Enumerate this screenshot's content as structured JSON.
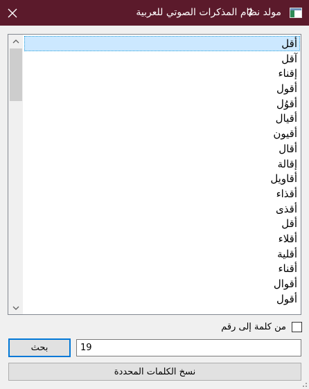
{
  "window": {
    "title": "مولد نظام المذكرات الصوتي للعربية",
    "help_label": "?"
  },
  "word_list": {
    "items": [
      "أقل",
      "آقل",
      "إقناء",
      "أقول",
      "أقوُل",
      "أقيال",
      "أقيون",
      "أقال",
      "إقالة",
      "أقاويل",
      "أقذاء",
      "أقذى",
      "أقل",
      "أقلاء",
      "أقلية",
      "أقناء",
      "أقوال",
      "أقول"
    ],
    "selected_index": 0
  },
  "options": {
    "word_to_number_label": "من كلمة إلى رقم",
    "word_to_number_checked": false
  },
  "search": {
    "button_label": "بحث",
    "number_value": "19"
  },
  "copy": {
    "button_label": "نسخ الكلمات المحددة"
  },
  "colors": {
    "titlebar": "#5b1a2b",
    "selection": "#cce8ff",
    "focus_border": "#0078d7"
  }
}
